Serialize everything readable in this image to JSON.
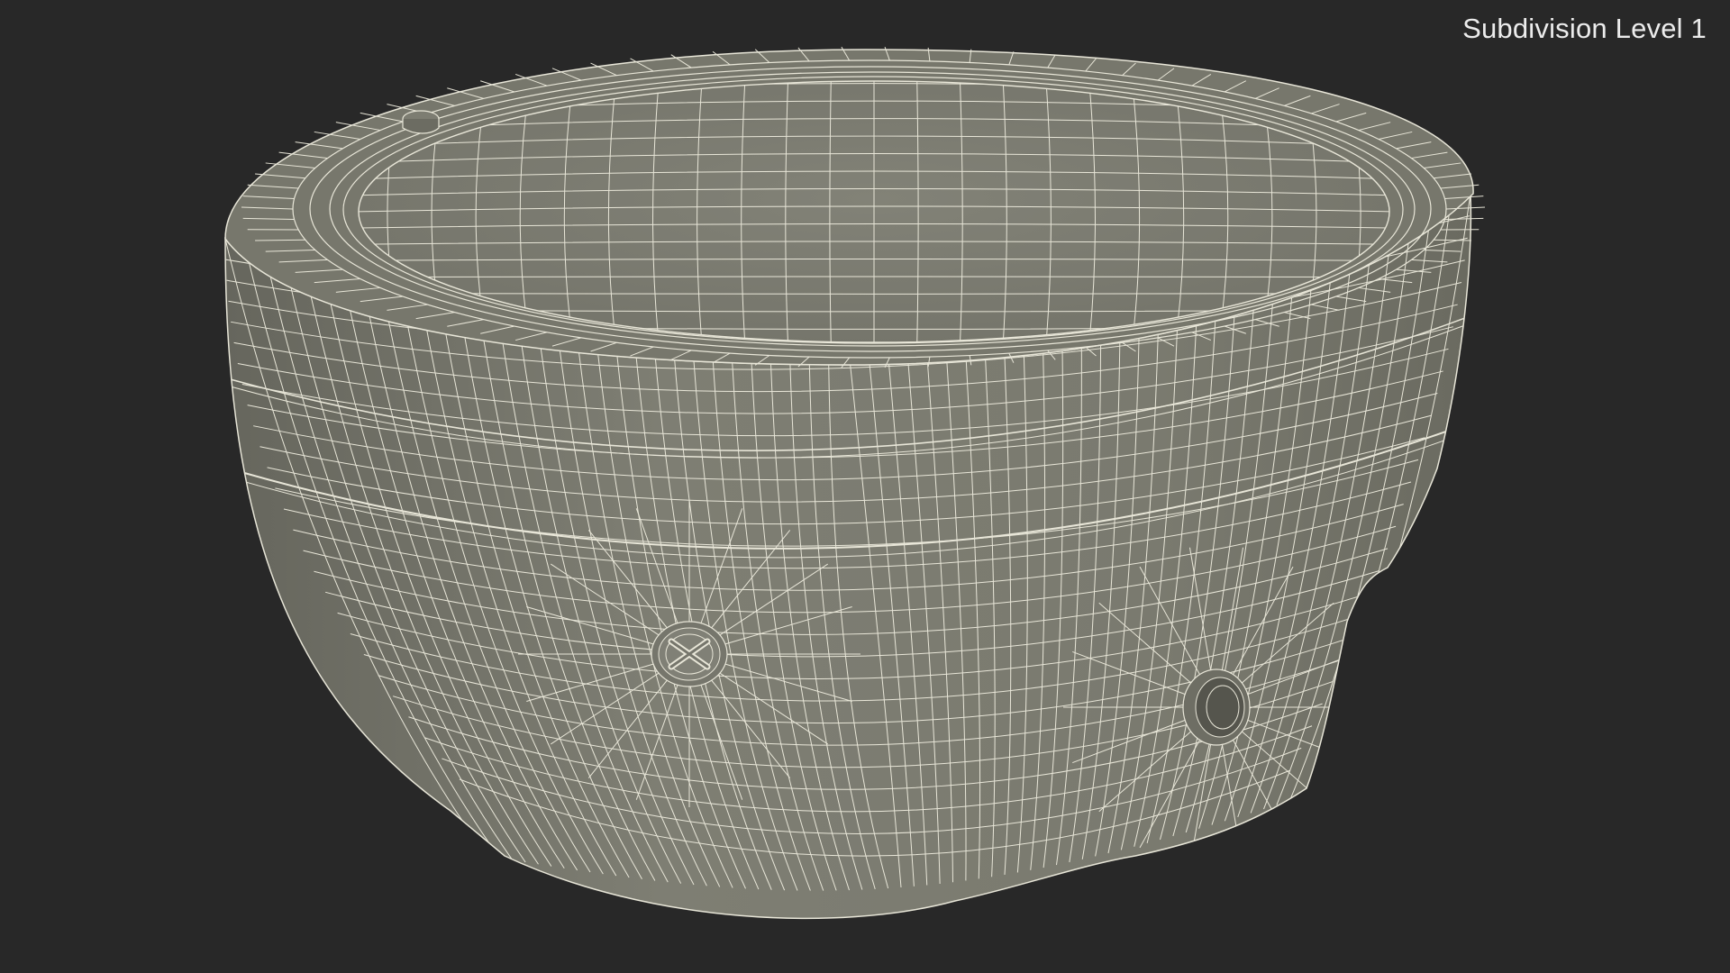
{
  "overlay": {
    "subdivision_label": "Subdivision Level 1"
  },
  "model": {
    "subject": "wireframe-bowl-mount",
    "display_mode": "wireframe-on-shaded"
  },
  "colors": {
    "background": "#282828",
    "surface": "#7b7b70",
    "surface_shadow": "#5f5f56",
    "wire": "#e8e6d8",
    "label_text": "#ececec"
  }
}
